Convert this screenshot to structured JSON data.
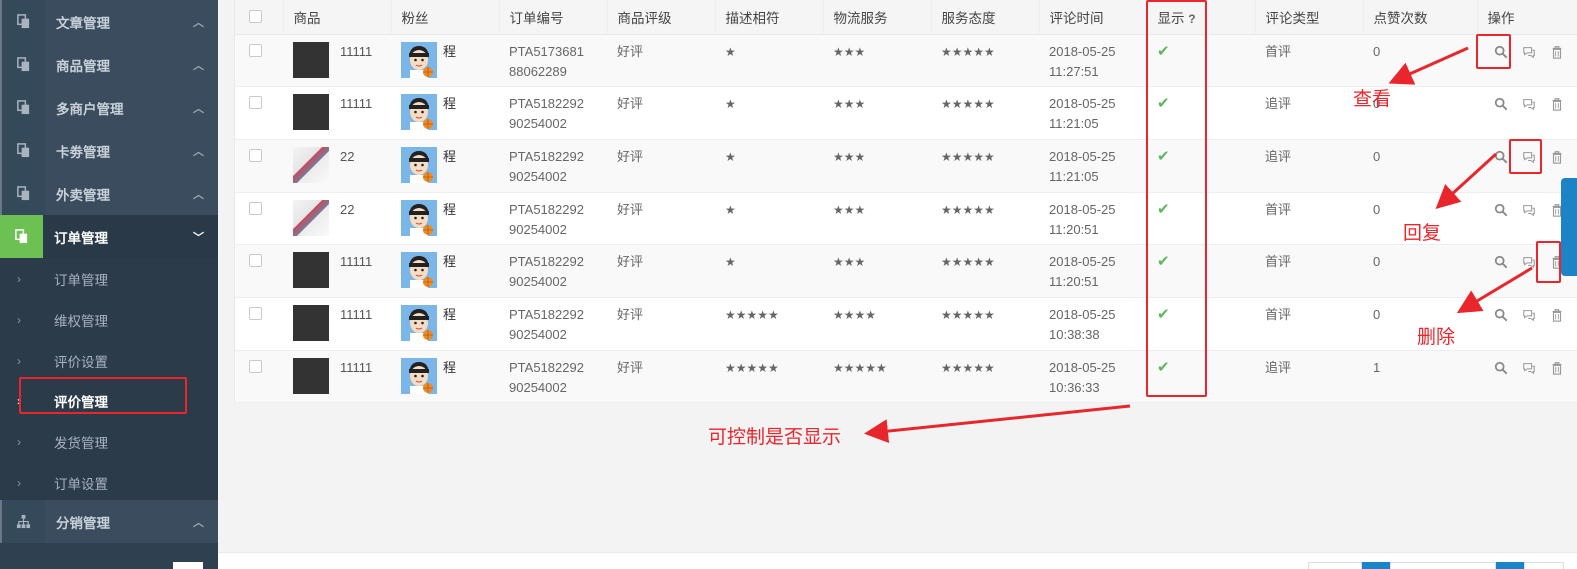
{
  "sidebar": {
    "menus": [
      {
        "label": "文章管理",
        "icon": "copy-icon"
      },
      {
        "label": "商品管理",
        "icon": "copy-icon"
      },
      {
        "label": "多商户管理",
        "icon": "copy-icon"
      },
      {
        "label": "卡劵管理",
        "icon": "copy-icon"
      },
      {
        "label": "外卖管理",
        "icon": "copy-icon"
      },
      {
        "label": "订单管理",
        "icon": "copy-icon"
      }
    ],
    "sub_items": [
      "订单管理",
      "维权管理",
      "评价设置",
      "评价管理",
      "发货管理",
      "订单设置"
    ],
    "bottom_menu": {
      "label": "分销管理",
      "icon": "sitemap-icon"
    }
  },
  "table": {
    "headers": [
      "商品",
      "粉丝",
      "订单编号",
      "商品评级",
      "描述相符",
      "物流服务",
      "服务态度",
      "评论时间",
      "显示",
      "评论类型",
      "点赞次数",
      "操作"
    ],
    "help_mark": "?",
    "rows": [
      {
        "goods": "11111",
        "fan": "程",
        "order": "PTA517368188062289",
        "rating": "好评",
        "desc": "★",
        "logistics": "★★★",
        "service": "★★★★★",
        "time1": "2018-05-25",
        "time2": "11:27:51",
        "shown": "✔",
        "type": "首评",
        "likes": "0"
      },
      {
        "goods": "11111",
        "fan": "程",
        "order": "PTA518229290254002",
        "rating": "好评",
        "desc": "★",
        "logistics": "★★★",
        "service": "★★★★★",
        "time1": "2018-05-25",
        "time2": "11:21:05",
        "shown": "✔",
        "type": "追评",
        "likes": "0"
      },
      {
        "goods": "22",
        "fan": "程",
        "order": "PTA518229290254002",
        "rating": "好评",
        "desc": "★",
        "logistics": "★★★",
        "service": "★★★★★",
        "time1": "2018-05-25",
        "time2": "11:21:05",
        "shown": "✔",
        "type": "追评",
        "likes": "0"
      },
      {
        "goods": "22",
        "fan": "程",
        "order": "PTA518229290254002",
        "rating": "好评",
        "desc": "★",
        "logistics": "★★★",
        "service": "★★★★★",
        "time1": "2018-05-25",
        "time2": "11:20:51",
        "shown": "✔",
        "type": "首评",
        "likes": "0"
      },
      {
        "goods": "11111",
        "fan": "程",
        "order": "PTA518229290254002",
        "rating": "好评",
        "desc": "★",
        "logistics": "★★★",
        "service": "★★★★★",
        "time1": "2018-05-25",
        "time2": "11:20:51",
        "shown": "✔",
        "type": "首评",
        "likes": "0"
      },
      {
        "goods": "11111",
        "fan": "程",
        "order": "PTA518229290254002",
        "rating": "好评",
        "desc": "★★★★★",
        "logistics": "★★★★",
        "service": "★★★★★",
        "time1": "2018-05-25",
        "time2": "10:38:38",
        "shown": "✔",
        "type": "首评",
        "likes": "0"
      },
      {
        "goods": "11111",
        "fan": "程",
        "order": "PTA518229290254002",
        "rating": "好评",
        "desc": "★★★★★",
        "logistics": "★★★★★",
        "service": "★★★★★",
        "time1": "2018-05-25",
        "time2": "10:36:33",
        "shown": "✔",
        "type": "追评",
        "likes": "1"
      }
    ]
  },
  "annotations": {
    "view": "查看",
    "reply": "回复",
    "delete": "删除",
    "control_display": "可控制是否显示"
  },
  "colors": {
    "sidebar_bg": "#2f4050",
    "active_green": "#6cc152",
    "annotation_red": "#e8262b",
    "check_green": "#5cb85c",
    "pager_blue": "#1c84c6"
  }
}
